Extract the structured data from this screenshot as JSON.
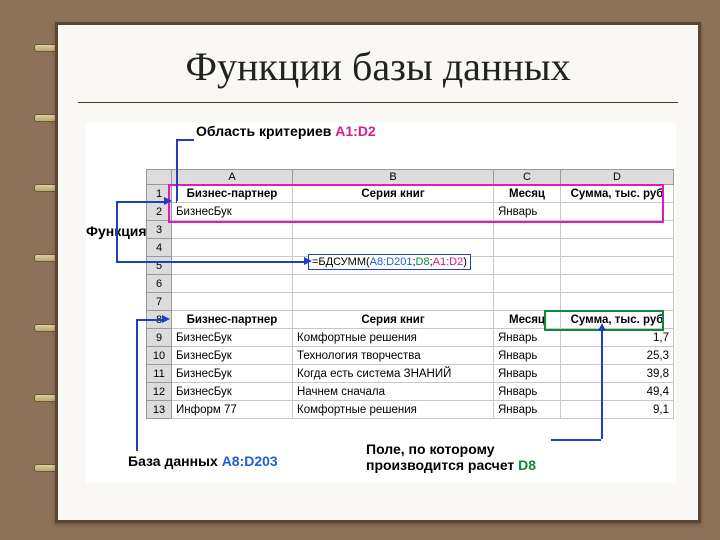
{
  "title": "Функции базы данных",
  "labels": {
    "criteria_prefix": "Область критериев ",
    "criteria_range": "A1:D2",
    "function": "Функция",
    "db_prefix": "База данных ",
    "db_range": "A8:D203",
    "field_line1": "Поле, по которому",
    "field_line2": "производится расчет ",
    "field_range": "D8"
  },
  "columns": [
    "A",
    "B",
    "C",
    "D"
  ],
  "criteria": {
    "headers": [
      "Бизнес-партнер",
      "Серия книг",
      "Месяц",
      "Сумма, тыс. руб"
    ],
    "row": [
      "БизнесБук",
      "",
      "Январь",
      ""
    ]
  },
  "formula": {
    "prefix": "=БДСУММ(",
    "arg1": "A8:D201",
    "sep": ";",
    "arg2": "D8",
    "arg3": "A1:D2",
    "suffix": ")"
  },
  "db": {
    "headers": [
      "Бизнес-партнер",
      "Серия книг",
      "Месяц",
      "Сумма, тыс. руб"
    ],
    "rows": [
      [
        "БизнесБук",
        "Комфортные решения",
        "Январь",
        "1,7"
      ],
      [
        "БизнесБук",
        "Технология творчества",
        "Январь",
        "25,3"
      ],
      [
        "БизнесБук",
        "Когда есть система ЗНАНИЙ",
        "Январь",
        "39,8"
      ],
      [
        "БизнесБук",
        "Начнем сначала",
        "Январь",
        "49,4"
      ],
      [
        "Информ 77",
        "Комфортные решения",
        "Январь",
        "9,1"
      ]
    ]
  },
  "row_numbers": [
    1,
    2,
    3,
    4,
    5,
    6,
    7,
    8,
    9,
    10,
    11,
    12,
    13
  ]
}
